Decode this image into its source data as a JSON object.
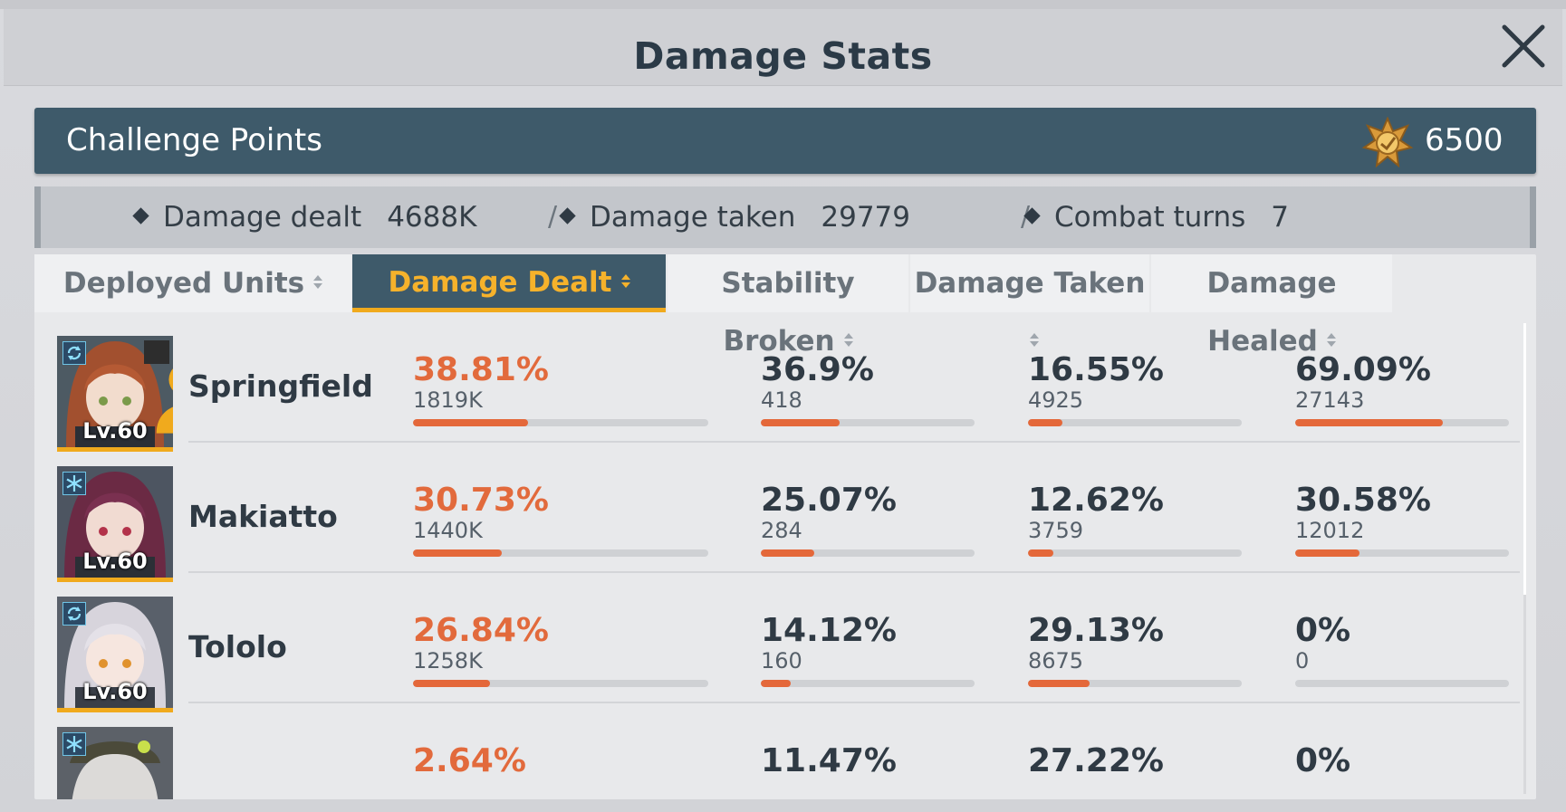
{
  "window": {
    "title": "Damage Stats"
  },
  "challenge": {
    "label": "Challenge Points",
    "value": "6500"
  },
  "summary": [
    {
      "label": "Damage dealt",
      "value": "4688K"
    },
    {
      "label": "Damage taken",
      "value": "29779"
    },
    {
      "label": "Combat turns",
      "value": "7"
    }
  ],
  "separator": "/",
  "columns": [
    "Deployed Units",
    "Damage Dealt",
    "Stability Broken",
    "Damage Taken",
    "Damage Healed"
  ],
  "active_column": "Damage Dealt",
  "units": [
    {
      "name": "Springfield",
      "level": "Lv.60",
      "element_icon": "rotate-icon",
      "squad_icon": true,
      "stats": [
        {
          "pct": "38.81%",
          "raw": "1819K",
          "fill": 0.39
        },
        {
          "pct": "36.9%",
          "raw": "418",
          "fill": 0.37
        },
        {
          "pct": "16.55%",
          "raw": "4925",
          "fill": 0.16
        },
        {
          "pct": "69.09%",
          "raw": "27143",
          "fill": 0.69
        }
      ]
    },
    {
      "name": "Makiatto",
      "level": "Lv.60",
      "element_icon": "snowflake-icon",
      "squad_icon": false,
      "stats": [
        {
          "pct": "30.73%",
          "raw": "1440K",
          "fill": 0.3
        },
        {
          "pct": "25.07%",
          "raw": "284",
          "fill": 0.25
        },
        {
          "pct": "12.62%",
          "raw": "3759",
          "fill": 0.12
        },
        {
          "pct": "30.58%",
          "raw": "12012",
          "fill": 0.3
        }
      ]
    },
    {
      "name": "Tololo",
      "level": "Lv.60",
      "element_icon": "rotate-icon",
      "squad_icon": false,
      "stats": [
        {
          "pct": "26.84%",
          "raw": "1258K",
          "fill": 0.26
        },
        {
          "pct": "14.12%",
          "raw": "160",
          "fill": 0.14
        },
        {
          "pct": "29.13%",
          "raw": "8675",
          "fill": 0.29
        },
        {
          "pct": "0%",
          "raw": "0",
          "fill": 0
        }
      ]
    },
    {
      "name": "",
      "level": "",
      "element_icon": "snowflake-icon",
      "squad_icon": false,
      "stats": [
        {
          "pct": "2.64%",
          "raw": "",
          "fill": 0.03
        },
        {
          "pct": "11.47%",
          "raw": "",
          "fill": 0.11
        },
        {
          "pct": "27.22%",
          "raw": "",
          "fill": 0.27
        },
        {
          "pct": "0%",
          "raw": "",
          "fill": 0
        }
      ]
    }
  ],
  "colors": {
    "accent": "#f0aa1d",
    "header_dark": "#3e5a6a",
    "bar_fill": "#e4683a",
    "damage_dealt_text": "#e26a3c"
  }
}
